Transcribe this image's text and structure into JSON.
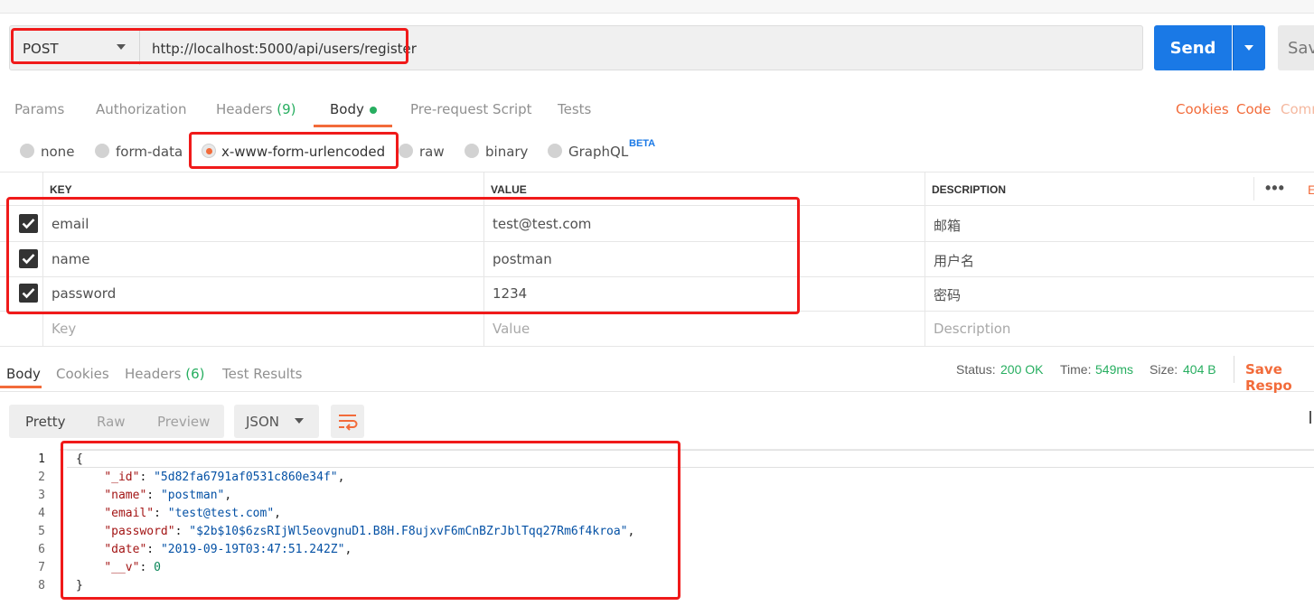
{
  "request": {
    "method": "POST",
    "url": "http://localhost:5000/api/users/register",
    "send_label": "Send",
    "save_label": "Sav"
  },
  "request_tabs": {
    "params": "Params",
    "authorization": "Authorization",
    "headers": "Headers",
    "headers_count": "(9)",
    "body": "Body",
    "prerequest": "Pre-request Script",
    "tests": "Tests"
  },
  "right_links": {
    "cookies": "Cookies",
    "code": "Code",
    "comments": "Comm"
  },
  "body_modes": {
    "none": "none",
    "form_data": "form-data",
    "urlencoded": "x-www-form-urlencoded",
    "raw": "raw",
    "binary": "binary",
    "graphql": "GraphQL",
    "beta": "BETA",
    "selected": "x-www-form-urlencoded"
  },
  "params_table": {
    "headers": {
      "key": "KEY",
      "value": "VALUE",
      "description": "DESCRIPTION"
    },
    "more": "•••",
    "bulk_edit": "E",
    "rows": [
      {
        "checked": true,
        "key": "email",
        "value": "test@test.com",
        "description": "邮箱"
      },
      {
        "checked": true,
        "key": "name",
        "value": "postman",
        "description": "用户名"
      },
      {
        "checked": true,
        "key": "password",
        "value": "1234",
        "description": "密码"
      }
    ],
    "placeholder": {
      "key": "Key",
      "value": "Value",
      "description": "Description"
    }
  },
  "response": {
    "tabs": {
      "body": "Body",
      "cookies": "Cookies",
      "headers": "Headers",
      "headers_count": "(6)",
      "test_results": "Test Results"
    },
    "status_label": "Status:",
    "status_value": "200 OK",
    "time_label": "Time:",
    "time_value": "549ms",
    "size_label": "Size:",
    "size_value": "404 B",
    "save_response": "Save Respo",
    "view_modes": {
      "pretty": "Pretty",
      "raw": "Raw",
      "preview": "Preview"
    },
    "format": "JSON",
    "json_lines": [
      {
        "n": "1",
        "open": "{"
      },
      {
        "n": "2",
        "key": "\"_id\"",
        "val": "\"5d82fa6791af0531c860e34f\"",
        "type": "s",
        "comma": ","
      },
      {
        "n": "3",
        "key": "\"name\"",
        "val": "\"postman\"",
        "type": "s",
        "comma": ","
      },
      {
        "n": "4",
        "key": "\"email\"",
        "val": "\"test@test.com\"",
        "type": "s",
        "comma": ","
      },
      {
        "n": "5",
        "key": "\"password\"",
        "val": "\"$2b$10$6zsRIjWl5eovgnuD1.B8H.F8ujxvF6mCnBZrJblTqq27Rm6f4kroa\"",
        "type": "s",
        "comma": ","
      },
      {
        "n": "6",
        "key": "\"date\"",
        "val": "\"2019-09-19T03:47:51.242Z\"",
        "type": "s",
        "comma": ","
      },
      {
        "n": "7",
        "key": "\"__v\"",
        "val": "0",
        "type": "n",
        "comma": ""
      },
      {
        "n": "8",
        "open": "}"
      }
    ]
  },
  "colors": {
    "accent": "#f26b3a",
    "send_blue": "#1a79e6",
    "success": "#27ae60",
    "highlight_red": "#f01a1a"
  }
}
